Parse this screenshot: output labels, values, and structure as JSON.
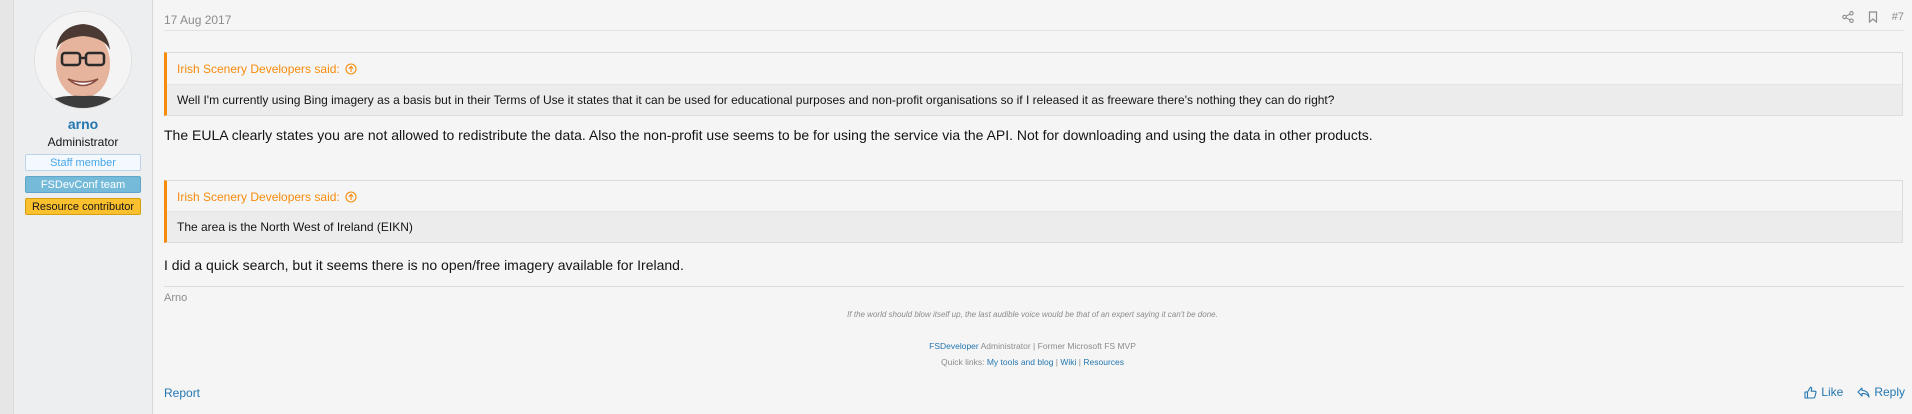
{
  "user": {
    "name": "arno",
    "title": "Administrator",
    "banners": [
      "Staff member",
      "FSDevConf team",
      "Resource contributor"
    ]
  },
  "post": {
    "date": "17 Aug 2017",
    "number": "#7",
    "quotes": [
      {
        "author": "Irish Scenery Developers said:",
        "text": "Well I'm currently using Bing imagery as a basis but in their Terms of Use it states that it can be used for educational purposes and non-profit organisations so if I released it as freeware there's nothing they can do right?"
      },
      {
        "author": "Irish Scenery Developers said:",
        "text": "The area is the North West of Ireland (EIKN)"
      }
    ],
    "paragraphs": [
      "The EULA clearly states you are not allowed to redistribute the data. Also the non-profit use seems to be for using the service via the API. Not for downloading and using the data in other products.",
      "I did a quick search, but it seems there is no open/free imagery available for Ireland."
    ]
  },
  "signature": {
    "name": "Arno",
    "quote": "If the world should blow itself up, the last audible voice would be that of an expert saying it can't be done.",
    "line1_link": "FSDeveloper",
    "line1_text": " Administrator | Former Microsoft FS MVP",
    "line2_prefix": "Quick links: ",
    "line2_link1": "My tools and blog",
    "line2_sep1": " | ",
    "line2_link2": "Wiki",
    "line2_sep2": " | ",
    "line2_link3": "Resources"
  },
  "actions": {
    "report": "Report",
    "like": "Like",
    "reply": "Reply"
  },
  "colors": {
    "accent": "#2577b1",
    "quote_border": "#f78c0c",
    "banner_team": "#75bbd9",
    "banner_resource": "#fbc02d"
  },
  "icons": [
    "share-icon",
    "bookmark-icon",
    "arrow-up-circle-icon",
    "thumbs-up-icon",
    "reply-icon"
  ]
}
